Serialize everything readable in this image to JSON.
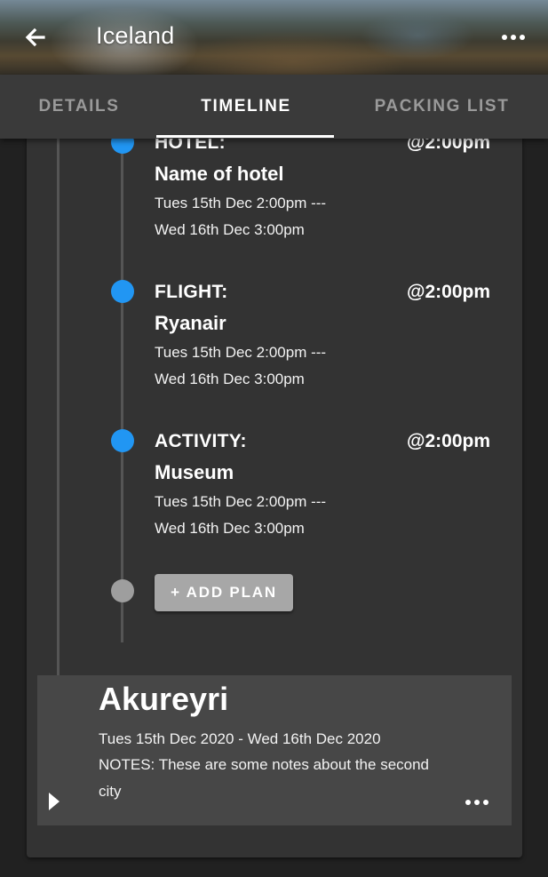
{
  "header": {
    "title": "Iceland",
    "back_icon": "arrow-left-icon",
    "more_icon": "more-horizontal-icon"
  },
  "tabs": [
    {
      "label": "DETAILS",
      "active": false
    },
    {
      "label": "TIMELINE",
      "active": true
    },
    {
      "label": "PACKING LIST",
      "active": false
    }
  ],
  "timeline": {
    "plans": [
      {
        "type": "HOTEL:",
        "time": "@2:00pm",
        "name": "Name of hotel",
        "dates_line1": "Tues 15th Dec 2:00pm ---",
        "dates_line2": "Wed 16th Dec 3:00pm"
      },
      {
        "type": "FLIGHT:",
        "time": "@2:00pm",
        "name": "Ryanair",
        "dates_line1": "Tues 15th Dec 2:00pm ---",
        "dates_line2": "Wed 16th Dec 3:00pm"
      },
      {
        "type": "ACTIVITY:",
        "time": "@2:00pm",
        "name": "Museum",
        "dates_line1": "Tues 15th Dec 2:00pm ---",
        "dates_line2": "Wed 16th Dec 3:00pm"
      }
    ],
    "add_plan_label": "+ ADD PLAN"
  },
  "city": {
    "name": "Akureyri",
    "dates": "Tues 15th Dec 2020 - Wed 16th Dec 2020",
    "notes": "NOTES: These are some notes about the second city"
  },
  "colors": {
    "accent": "#2196f3",
    "background": "#212121",
    "panel": "#333333",
    "tabbar": "#3a3a3a",
    "city_card": "#474747"
  }
}
